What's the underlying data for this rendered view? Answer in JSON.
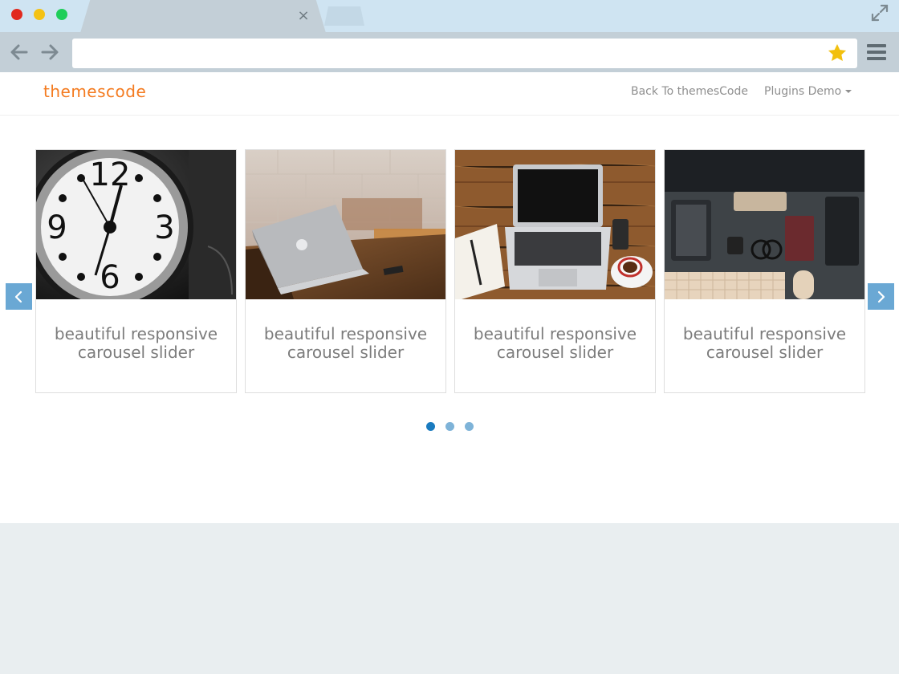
{
  "browser": {
    "address_value": "",
    "colors": {
      "titlebar": "#cfe4f2",
      "toolbar": "#c3cfd7",
      "star": "#f2c00e"
    }
  },
  "site": {
    "brand": "themescode",
    "brand_color": "#f47b20",
    "nav": {
      "back_link": "Back To themesCode",
      "plugins_demo": "Plugins Demo"
    }
  },
  "carousel": {
    "slides": [
      {
        "image": "clock-photo",
        "caption_line1": "beautiful responsive",
        "caption_line2": "carousel slider"
      },
      {
        "image": "laptop-on-table-photo",
        "caption_line1": "beautiful responsive",
        "caption_line2": "carousel slider"
      },
      {
        "image": "laptop-desk-coffee-photo",
        "caption_line1": "beautiful responsive",
        "caption_line2": "carousel slider"
      },
      {
        "image": "dark-desk-setup-photo",
        "caption_line1": "beautiful responsive",
        "caption_line2": "carousel slider"
      }
    ],
    "dots": {
      "count": 3,
      "active_index": 0,
      "active_color": "#1a7bbf",
      "inactive_color": "#7eb3d8"
    },
    "arrow_color": "#6aa8d4"
  }
}
